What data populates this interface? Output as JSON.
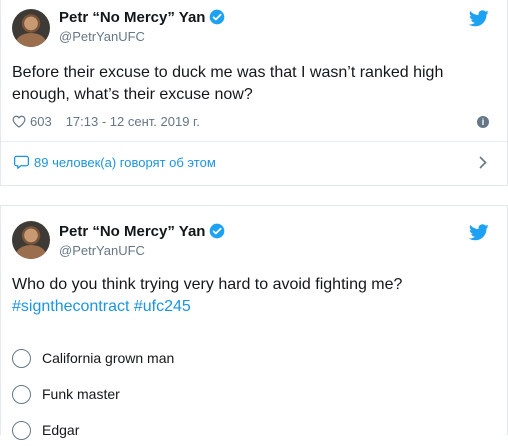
{
  "tweets": [
    {
      "author": {
        "name": "Petr “No Mercy” Yan",
        "handle": "@PetrYanUFC"
      },
      "text": "Before their excuse to duck me was that I wasn’t ranked high enough, what’s their excuse now?",
      "likes": "603",
      "timestamp": "17:13 - 12 сент. 2019 г.",
      "conversation_label": "89 человек(а) говорят об этом"
    },
    {
      "author": {
        "name": "Petr “No Mercy” Yan",
        "handle": "@PetrYanUFC"
      },
      "text": "Who do you think trying very hard to avoid fighting me?",
      "hashtags": [
        "#signthecontract",
        "#ufc245"
      ],
      "poll_options": [
        "California grown man",
        "Funk master",
        "Edgar"
      ]
    }
  ],
  "icons": {
    "verified": "verified-badge-icon",
    "bird": "twitter-bird-icon",
    "heart": "heart-icon",
    "info": "info-icon",
    "bubble": "speech-bubble-icon",
    "chevron": "chevron-right-icon"
  },
  "colors": {
    "accent": "#1b95e0",
    "text": "#14171a",
    "muted": "#657786"
  }
}
